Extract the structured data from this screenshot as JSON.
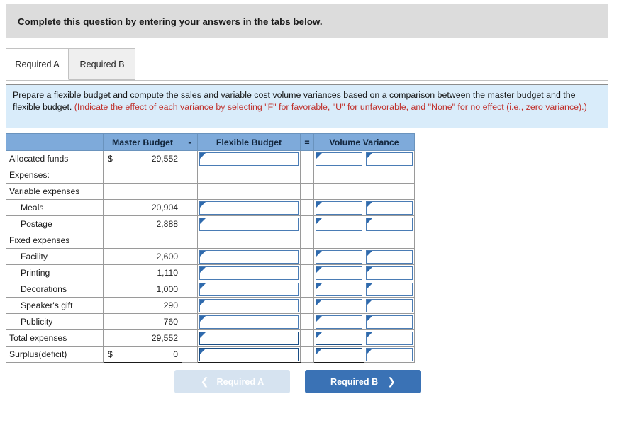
{
  "banner": {
    "text": "Complete this question by entering your answers in the tabs below."
  },
  "tabs": [
    {
      "label": "Required A",
      "active": true
    },
    {
      "label": "Required B",
      "active": false
    }
  ],
  "instruction": {
    "plain_part1": "Prepare a flexible budget and compute the sales and variable cost volume variances based on a comparison between the master budget and the flexible budget. ",
    "red_part": "(Indicate the effect of each variance by selecting \"F\" for favorable, \"U\" for unfavorable, and \"None\" for no effect (i.e., zero variance).)"
  },
  "table": {
    "headers": {
      "blank": "",
      "master_budget": "Master Budget",
      "minus": "-",
      "flexible_budget": "Flexible Budget",
      "equals": "=",
      "volume_variance": "Volume Variance"
    },
    "rows": [
      {
        "label": "Allocated funds",
        "indent": false,
        "currency": "$",
        "amount": "29,552",
        "has_inputs": true,
        "topline": false,
        "botline": false
      },
      {
        "label": "Expenses:",
        "indent": false,
        "currency": "",
        "amount": "",
        "has_inputs": false,
        "topline": false,
        "botline": false
      },
      {
        "label": "Variable expenses",
        "indent": false,
        "currency": "",
        "amount": "",
        "has_inputs": false,
        "topline": false,
        "botline": false
      },
      {
        "label": "Meals",
        "indent": true,
        "currency": "",
        "amount": "20,904",
        "has_inputs": true,
        "topline": false,
        "botline": false
      },
      {
        "label": "Postage",
        "indent": true,
        "currency": "",
        "amount": "2,888",
        "has_inputs": true,
        "topline": false,
        "botline": false
      },
      {
        "label": "Fixed expenses",
        "indent": false,
        "currency": "",
        "amount": "",
        "has_inputs": false,
        "topline": false,
        "botline": false
      },
      {
        "label": "Facility",
        "indent": true,
        "currency": "",
        "amount": "2,600",
        "has_inputs": true,
        "topline": false,
        "botline": false
      },
      {
        "label": "Printing",
        "indent": true,
        "currency": "",
        "amount": "1,110",
        "has_inputs": true,
        "topline": false,
        "botline": false
      },
      {
        "label": "Decorations",
        "indent": true,
        "currency": "",
        "amount": "1,000",
        "has_inputs": true,
        "topline": false,
        "botline": false
      },
      {
        "label": "Speaker's gift",
        "indent": true,
        "currency": "",
        "amount": "290",
        "has_inputs": true,
        "topline": false,
        "botline": false
      },
      {
        "label": "Publicity",
        "indent": true,
        "currency": "",
        "amount": "760",
        "has_inputs": true,
        "topline": false,
        "botline": false
      },
      {
        "label": "Total expenses",
        "indent": false,
        "currency": "",
        "amount": "29,552",
        "has_inputs": true,
        "topline": true,
        "botline": false
      },
      {
        "label": "Surplus(deficit)",
        "indent": false,
        "currency": "$",
        "amount": "0",
        "has_inputs": true,
        "topline": true,
        "botline": true
      }
    ],
    "input_value": ""
  },
  "nav": {
    "prev_label": "Required A",
    "prev_chevron": "❮",
    "prev_enabled": false,
    "next_label": "Required B",
    "next_chevron": "❯",
    "next_enabled": true
  },
  "colors": {
    "banner_gray": "#dcdcdc",
    "instruction_blue": "#d9ecfa",
    "header_blue": "#7eaada",
    "input_border": "#4a7cb5",
    "active_button": "#3a72b5",
    "disabled_button": "#d6e3f0",
    "red_text": "#c0302b"
  }
}
